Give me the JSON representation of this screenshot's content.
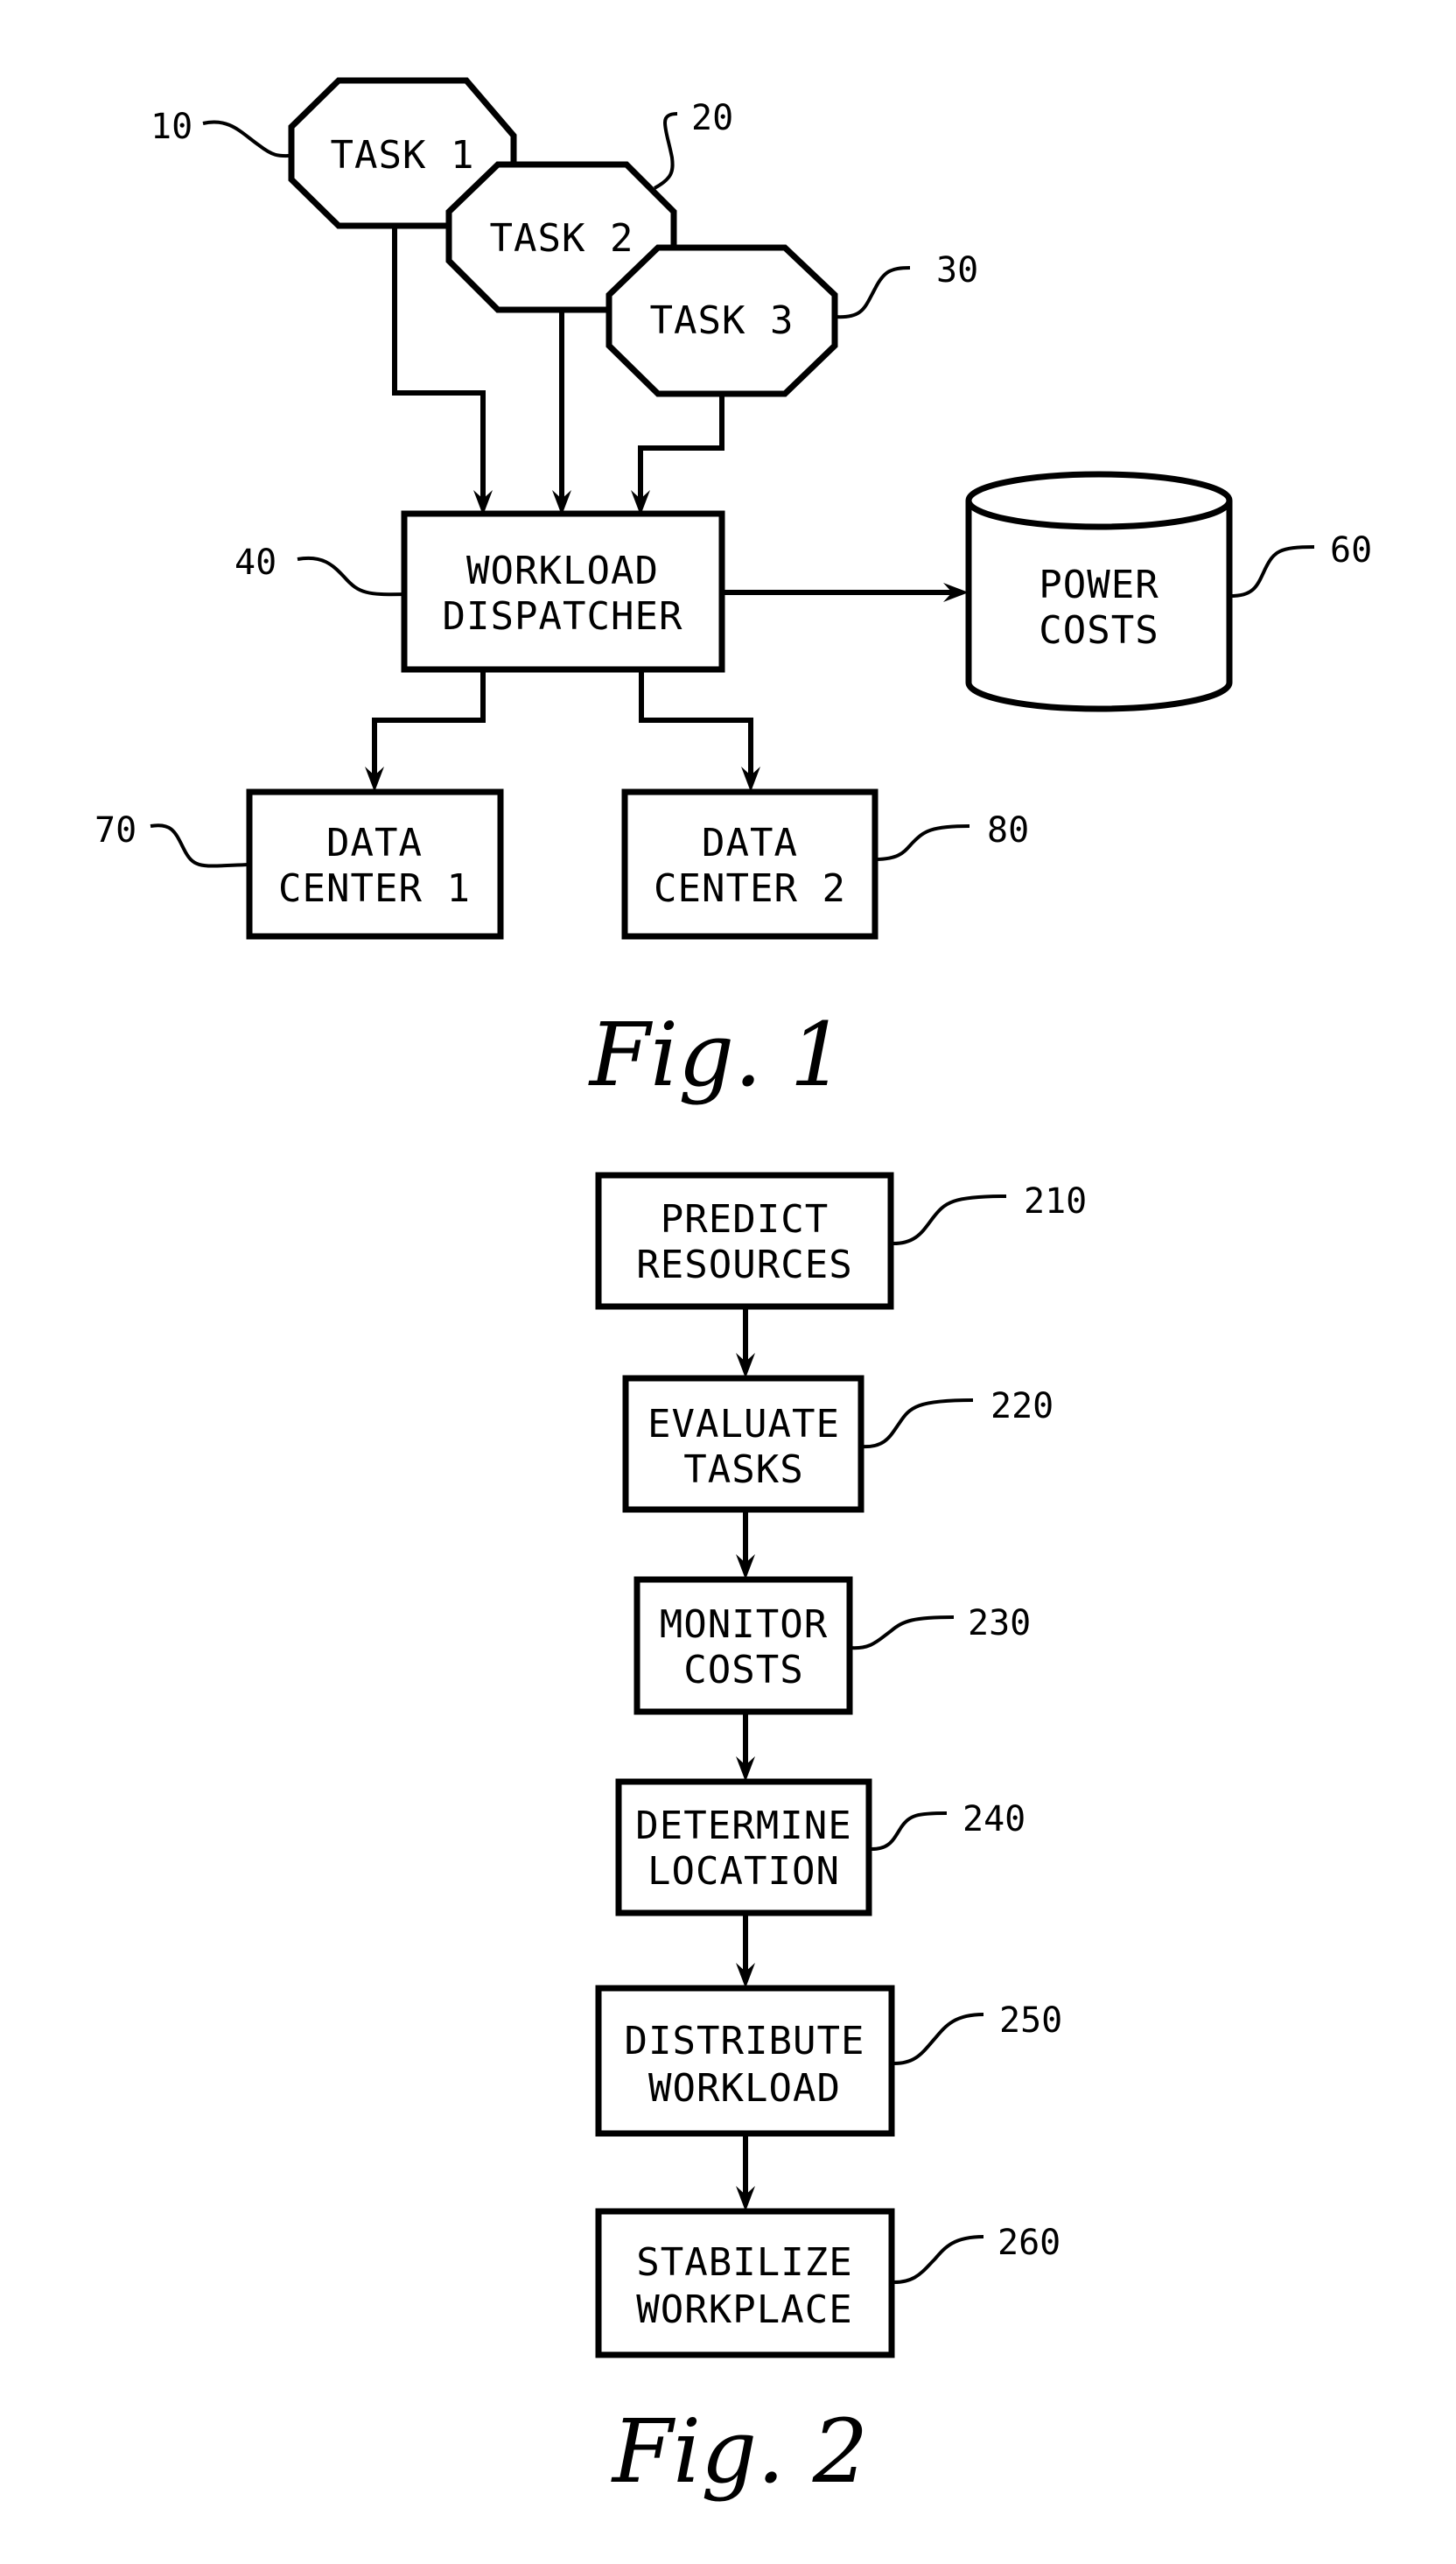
{
  "figure1": {
    "caption": "Fig. 1",
    "tasks": [
      {
        "ref": "10",
        "label": "TASK 1"
      },
      {
        "ref": "20",
        "label": "TASK 2"
      },
      {
        "ref": "30",
        "label": "TASK 3"
      }
    ],
    "dispatcher": {
      "ref": "40",
      "line1": "WORKLOAD",
      "line2": "DISPATCHER"
    },
    "power_costs": {
      "ref": "60",
      "line1": "POWER",
      "line2": "COSTS"
    },
    "data_centers": [
      {
        "ref": "70",
        "line1": "DATA",
        "line2": "CENTER 1"
      },
      {
        "ref": "80",
        "line1": "DATA",
        "line2": "CENTER 2"
      }
    ]
  },
  "figure2": {
    "caption": "Fig. 2",
    "steps": [
      {
        "ref": "210",
        "line1": "PREDICT",
        "line2": "RESOURCES"
      },
      {
        "ref": "220",
        "line1": "EVALUATE",
        "line2": "TASKS"
      },
      {
        "ref": "230",
        "line1": "MONITOR",
        "line2": "COSTS"
      },
      {
        "ref": "240",
        "line1": "DETERMINE",
        "line2": "LOCATION"
      },
      {
        "ref": "250",
        "line1": "DISTRIBUTE",
        "line2": "WORKLOAD"
      },
      {
        "ref": "260",
        "line1": "STABILIZE",
        "line2": "WORKPLACE"
      }
    ]
  }
}
